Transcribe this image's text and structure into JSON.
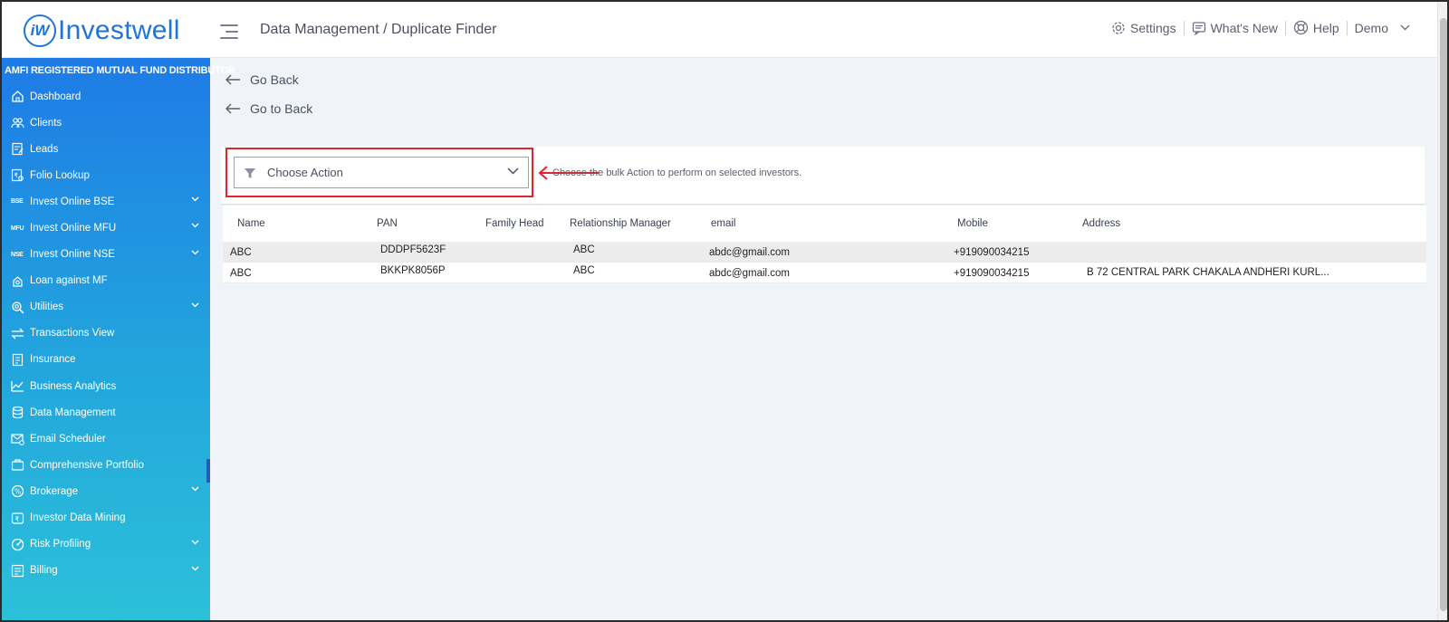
{
  "brand": {
    "logo_mark": "iW",
    "logo_text": "Investwell"
  },
  "header": {
    "breadcrumb": "Data Management / Duplicate Finder",
    "settings": "Settings",
    "whats_new": "What's New",
    "help": "Help",
    "user": "Demo"
  },
  "sidebar": {
    "registration": "AMFI REGISTERED MUTUAL FUND DISTRIBUTOR",
    "items": [
      {
        "label": "Dashboard",
        "icon": "home-icon",
        "expandable": false
      },
      {
        "label": "Clients",
        "icon": "clients-icon",
        "expandable": false
      },
      {
        "label": "Leads",
        "icon": "leads-icon",
        "expandable": false
      },
      {
        "label": "Folio Lookup",
        "icon": "folio-icon",
        "expandable": false
      },
      {
        "label": "Invest Online BSE",
        "badge": "BSE",
        "expandable": true
      },
      {
        "label": "Invest Online MFU",
        "badge": "MFU",
        "expandable": true
      },
      {
        "label": "Invest Online NSE",
        "badge": "NSE",
        "expandable": true
      },
      {
        "label": "Loan against MF",
        "icon": "loan-icon",
        "expandable": false
      },
      {
        "label": "Utilities",
        "icon": "utilities-icon",
        "expandable": true
      },
      {
        "label": "Transactions View",
        "icon": "transactions-icon",
        "expandable": false
      },
      {
        "label": "Insurance",
        "icon": "insurance-icon",
        "expandable": false
      },
      {
        "label": "Business Analytics",
        "icon": "analytics-icon",
        "expandable": false
      },
      {
        "label": "Data Management",
        "icon": "data-icon",
        "expandable": false
      },
      {
        "label": "Email Scheduler",
        "icon": "email-icon",
        "expandable": false
      },
      {
        "label": "Comprehensive Portfolio",
        "icon": "portfolio-icon",
        "expandable": false
      },
      {
        "label": "Brokerage",
        "icon": "brokerage-icon",
        "expandable": true
      },
      {
        "label": "Investor Data Mining",
        "icon": "mining-icon",
        "expandable": false
      },
      {
        "label": "Risk Profiling",
        "icon": "risk-icon",
        "expandable": true
      },
      {
        "label": "Billing",
        "icon": "billing-icon",
        "expandable": true
      }
    ]
  },
  "content": {
    "go_back": "Go Back",
    "go_to_back": "Go to Back",
    "action_placeholder": "Choose Action",
    "hint": "Choose the bulk Action to perform on selected investors.",
    "columns": [
      "Name",
      "PAN",
      "Family Head",
      "Relationship Manager",
      "email",
      "Mobile",
      "Address"
    ],
    "rows": [
      {
        "name": "ABC",
        "pan": "DDDPF5623F",
        "family_head": "",
        "rm": "ABC",
        "email": "abdc@gmail.com",
        "mobile": "+919090034215",
        "address": ""
      },
      {
        "name": "ABC",
        "pan": "BKKPK8056P",
        "family_head": "",
        "rm": "ABC",
        "email": "abdc@gmail.com",
        "mobile": "+919090034215",
        "address": "B 72 CENTRAL PARK CHAKALA ANDHERI KURL..."
      }
    ]
  },
  "colors": {
    "brand_blue": "#1f74d8",
    "highlight_red": "#e0242a",
    "sidebar_top": "#1e7be6",
    "sidebar_bottom": "#2cc0d9"
  }
}
